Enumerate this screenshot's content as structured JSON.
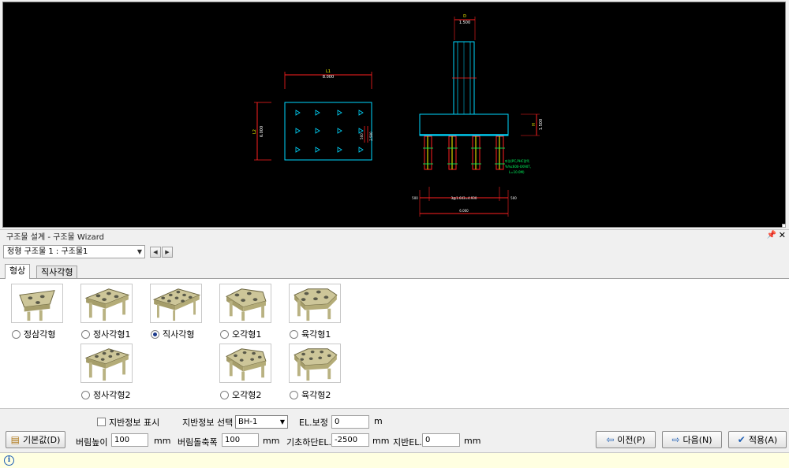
{
  "cad": {
    "plan_width_label": "L1",
    "plan_width_value": "8.000",
    "plan_height_label": "L2",
    "plan_height_value": "6.000",
    "plan_small_dim": "500",
    "plan_small_dim2": "2.500",
    "column_label": "D",
    "column_value": "1.500",
    "footing_height_label": "H",
    "footing_height_value": "1.500",
    "pile_note_1": "파일(PC,PHC말뚝",
    "pile_note_2": "%%c600-0X90T,",
    "pile_note_3": "L=10.0M)",
    "bottom_dim_left": "500",
    "bottom_dim_mid": "3@1.643=4.930",
    "bottom_dim_right": "500",
    "bottom_total": "6.000"
  },
  "panel": {
    "title": "구조물 설계 - 구조물 Wizard",
    "pin": "📌",
    "close": "✕"
  },
  "structure_select": {
    "value": "정형 구조물 1 : 구조물1"
  },
  "tabs": [
    {
      "label": "형상"
    },
    {
      "label": "직사각형"
    }
  ],
  "shapes": [
    {
      "label": "정삼각형",
      "checked": false
    },
    {
      "label": "정사각형1",
      "checked": false
    },
    {
      "label": "직사각형",
      "checked": true
    },
    {
      "label": "오각형1",
      "checked": false
    },
    {
      "label": "육각형1",
      "checked": false
    },
    {
      "label": "정사각형2",
      "checked": false
    },
    {
      "label": "오각형2",
      "checked": false
    },
    {
      "label": "육각형2",
      "checked": false
    }
  ],
  "controls": {
    "ground_info_show_label": "지반정보 표시",
    "ground_info_select_label": "지반정보 선택",
    "ground_info_select_value": "BH-1",
    "el_correction_label": "EL.보정",
    "el_correction_value": "0",
    "el_correction_unit": "m",
    "default_button": "기본값(D)",
    "pedestal_height_label": "버림높이",
    "pedestal_height_value": "100",
    "pedestal_height_unit": "mm",
    "pedestal_width_label": "버림돌축폭",
    "pedestal_width_value": "100",
    "pedestal_width_unit": "mm",
    "base_el_label": "기초하단EL.",
    "base_el_value": "-2500",
    "base_el_unit": "mm",
    "ground_el_label": "지반EL.",
    "ground_el_value": "0",
    "ground_el_unit": "mm",
    "prev_button": "이전(P)",
    "next_button": "다음(N)",
    "apply_button": "적용(A)"
  },
  "status": {
    "icon": "i"
  }
}
